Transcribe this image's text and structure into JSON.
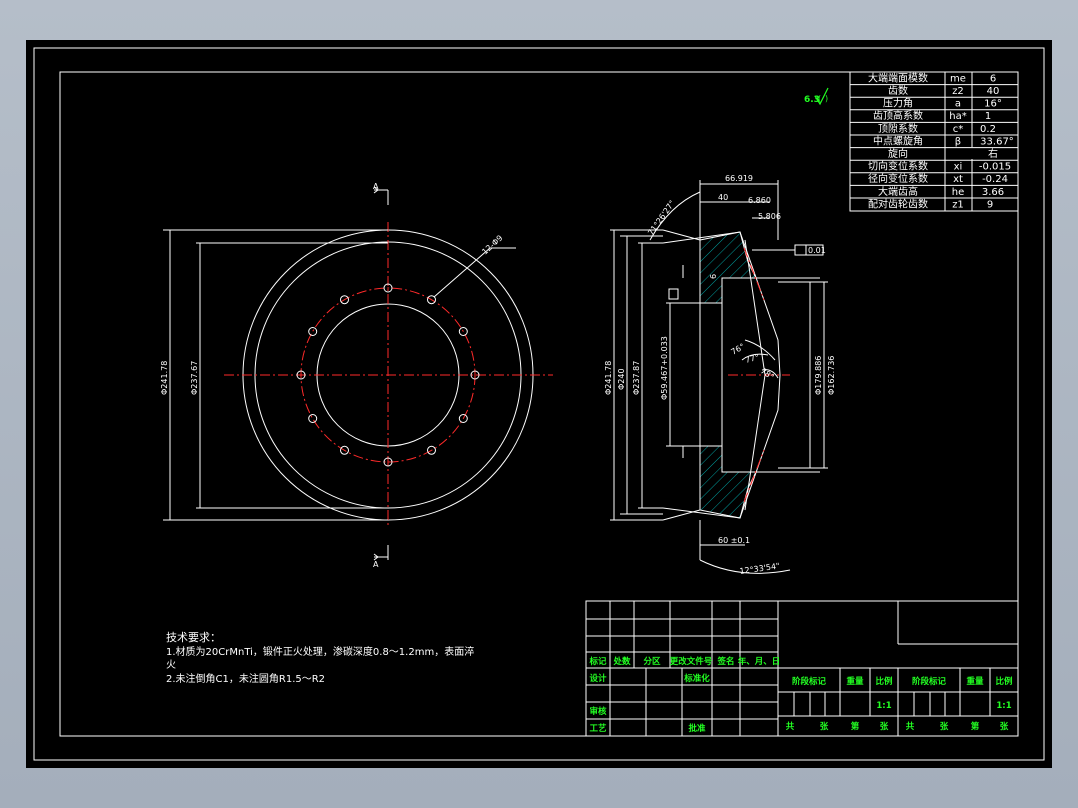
{
  "params": [
    {
      "name": "大端端面模数",
      "sym": "me",
      "val": "6"
    },
    {
      "name": "齿数",
      "sym": "z2",
      "val": "40"
    },
    {
      "name": "压力角",
      "sym": "a",
      "val": "16°"
    },
    {
      "name": "齿顶高系数",
      "sym": "ha*",
      "val": "1"
    },
    {
      "name": "顶隙系数",
      "sym": "c*",
      "val": "0.2"
    },
    {
      "name": "中点螺旋角",
      "sym": "β",
      "val": "33.67°"
    },
    {
      "name": "旋向",
      "sym": "",
      "val": "右"
    },
    {
      "name": "切向变位系数",
      "sym": "xi",
      "val": "-0.015"
    },
    {
      "name": "径向变位系数",
      "sym": "xt",
      "val": "-0.24"
    },
    {
      "name": "大端齿高",
      "sym": "he",
      "val": "3.66"
    },
    {
      "name": "配对齿轮齿数",
      "sym": "z1",
      "val": "9"
    }
  ],
  "roughness": "6.3",
  "front_view": {
    "section_mark_top": "A",
    "section_mark_bottom": "A",
    "hole_note": "12-Φ9",
    "dia_outer": "Φ241.78",
    "dia_inner": "Φ237.67"
  },
  "section_view": {
    "dim_66": "66.919",
    "dim_40": "40",
    "dim_6860": "6.860",
    "dim_5806": "5.806",
    "angle_top": "71°26'27\"",
    "angle_bottom": "12°33'54\"",
    "angle_face1": "76°",
    "angle_face2": "77°",
    "angle_face3": "78°",
    "tol_box": "0.01",
    "dia_241": "Φ241.78",
    "dia_240": "Φ240",
    "dia_237": "Φ237.87",
    "dia_hole": "Φ59.467+0.033",
    "dia_right1": "Φ179.886",
    "dia_right2": "Φ162.736",
    "small_label": "6",
    "bottom_note": "60 ±0.1"
  },
  "notes": {
    "heading": "技术要求：",
    "line1": "1.材质为20CrMnTi，锻件正火处理，渗碳深度0.8～1.2mm，表面淬",
    "line1b": "火",
    "line2": "2.未注倒角C1，未注圆角R1.5～R2"
  },
  "title_block": {
    "col_labels": [
      "标记",
      "处数",
      "分区",
      "更改文件号",
      "签名",
      "年、月、日"
    ],
    "design": "设计",
    "standard": "标准化",
    "review": "审核",
    "process": "工艺",
    "approve": "批准",
    "stage_mark": "阶段标记",
    "weight": "重量",
    "scale": "比例",
    "scale_val": "1:1",
    "total": "共",
    "sheets": "张",
    "no": "第",
    "sheet": "张"
  }
}
